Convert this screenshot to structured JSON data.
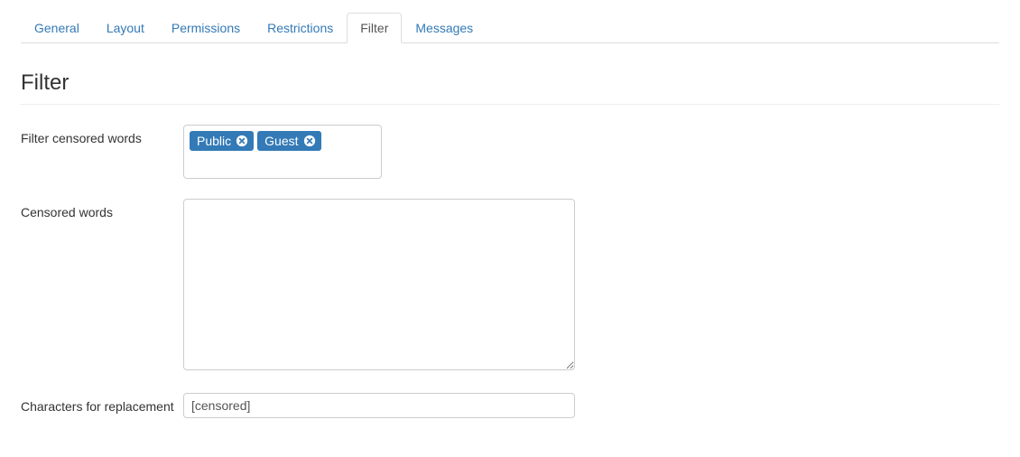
{
  "tabs": [
    {
      "label": "General",
      "active": false
    },
    {
      "label": "Layout",
      "active": false
    },
    {
      "label": "Permissions",
      "active": false
    },
    {
      "label": "Restrictions",
      "active": false
    },
    {
      "label": "Filter",
      "active": true
    },
    {
      "label": "Messages",
      "active": false
    }
  ],
  "page_title": "Filter",
  "form": {
    "filter_censored_words": {
      "label": "Filter censored words",
      "tags": [
        "Public",
        "Guest"
      ]
    },
    "censored_words": {
      "label": "Censored words",
      "value": ""
    },
    "replacement": {
      "label": "Characters for replacement",
      "value": "[censored]"
    }
  }
}
